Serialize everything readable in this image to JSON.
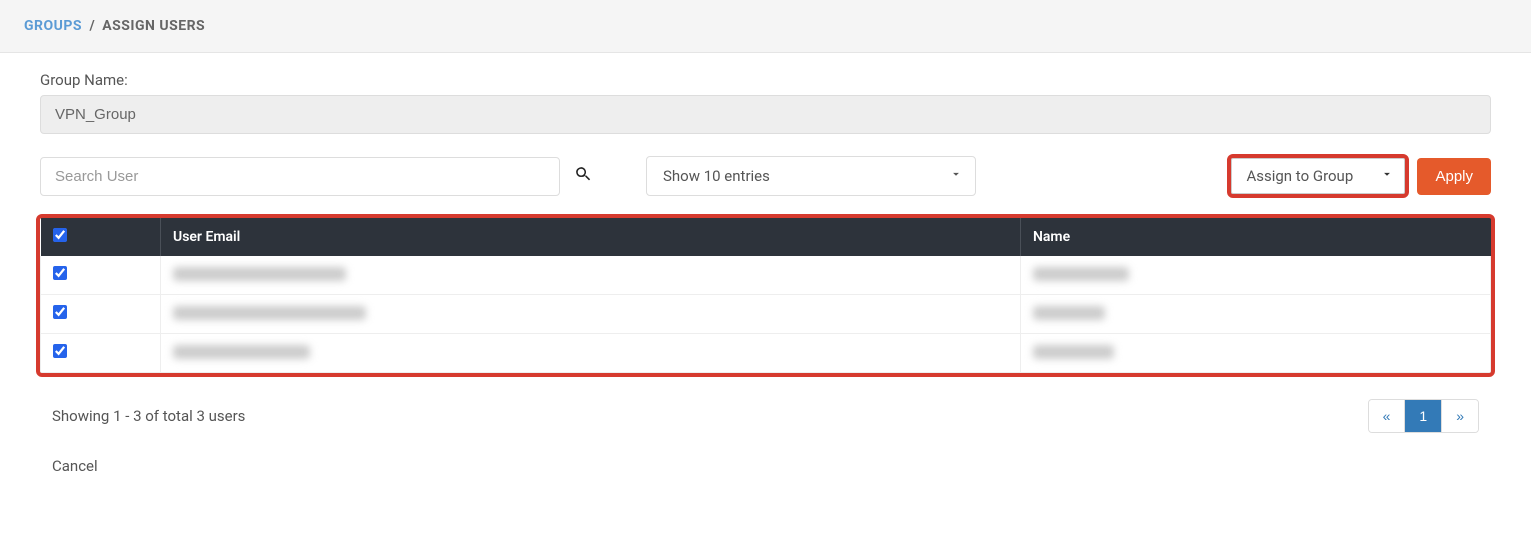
{
  "breadcrumb": {
    "link": "GROUPS",
    "sep": "/",
    "current": "ASSIGN USERS"
  },
  "form": {
    "group_name_label": "Group Name:",
    "group_name_value": "VPN_Group"
  },
  "controls": {
    "search_placeholder": "Search User",
    "entries_label": "Show 10 entries",
    "assign_label": "Assign to Group",
    "apply_label": "Apply"
  },
  "table": {
    "headers": {
      "email": "User Email",
      "name": "Name"
    },
    "rows": [
      {
        "checked": true,
        "email": "████████████████████",
        "name": "████████████"
      },
      {
        "checked": true,
        "email": "███████████████",
        "name": "██████"
      },
      {
        "checked": true,
        "email": "████████████████████",
        "name": "████████████"
      }
    ]
  },
  "footer": {
    "showing": "Showing 1 - 3 of total 3 users",
    "prev": "«",
    "page": "1",
    "next": "»",
    "cancel": "Cancel"
  }
}
